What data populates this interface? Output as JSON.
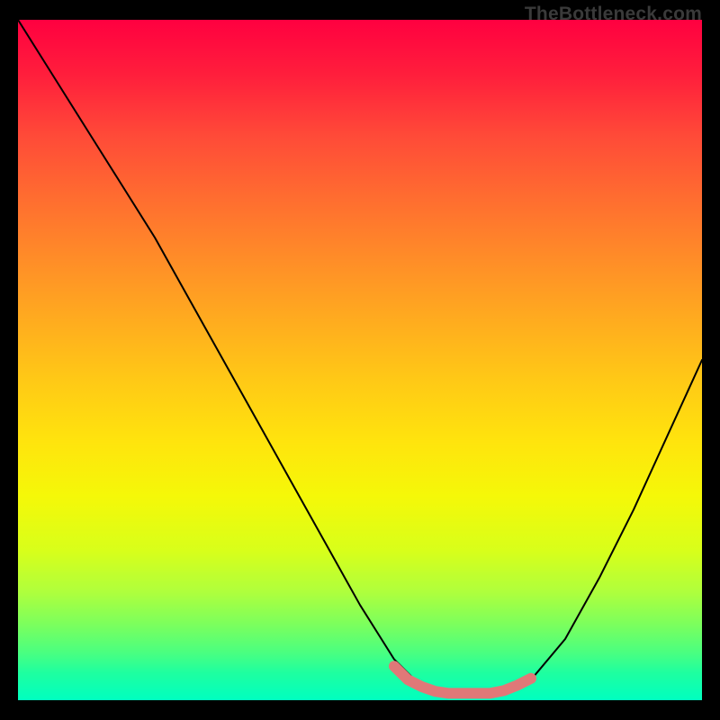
{
  "watermark": "TheBottleneck.com",
  "chart_data": {
    "type": "line",
    "title": "",
    "xlabel": "",
    "ylabel": "",
    "xlim": [
      0,
      100
    ],
    "ylim": [
      0,
      100
    ],
    "grid": false,
    "legend": false,
    "series": [
      {
        "name": "bottleneck-curve",
        "color": "#000000",
        "x": [
          0,
          5,
          10,
          15,
          20,
          25,
          30,
          35,
          40,
          45,
          50,
          55,
          58,
          60,
          62,
          65,
          68,
          70,
          72,
          75,
          80,
          85,
          90,
          95,
          100
        ],
        "values": [
          100,
          92,
          84,
          76,
          68,
          59,
          50,
          41,
          32,
          23,
          14,
          6,
          3,
          2,
          1.2,
          1,
          1,
          1,
          1.5,
          3,
          9,
          18,
          28,
          39,
          50
        ]
      },
      {
        "name": "highlight-segment",
        "color": "#e07878",
        "x": [
          55,
          57,
          59,
          61,
          63,
          65,
          67,
          69,
          71,
          73,
          75
        ],
        "values": [
          5,
          3,
          2,
          1.3,
          1,
          1,
          1,
          1,
          1.4,
          2.2,
          3.2
        ]
      }
    ],
    "gradient_stops": [
      {
        "pos": 0,
        "color": "#ff0040"
      },
      {
        "pos": 50,
        "color": "#ffd000"
      },
      {
        "pos": 80,
        "color": "#d0ff20"
      },
      {
        "pos": 100,
        "color": "#00ffc0"
      }
    ]
  }
}
